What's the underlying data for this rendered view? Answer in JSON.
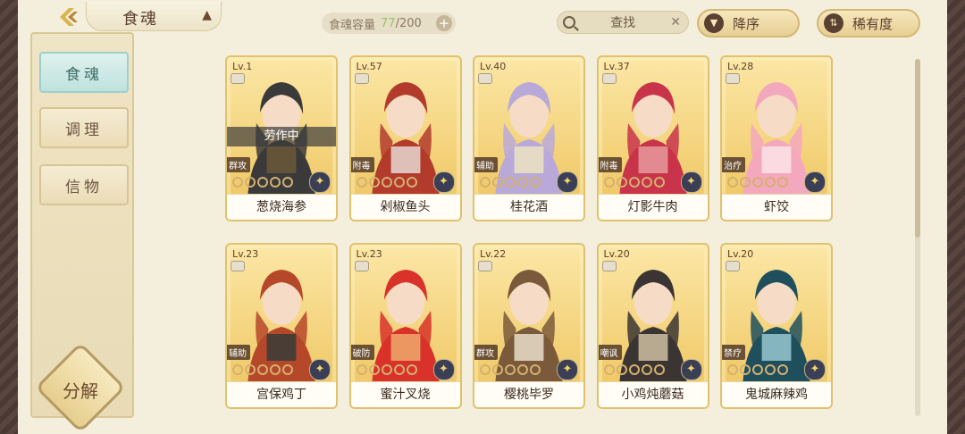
{
  "header": {
    "title": "食魂",
    "capacity_label": "食魂容量",
    "capacity_current": "77",
    "capacity_max": "/200",
    "add_symbol": "+",
    "search_placeholder": "查找",
    "search_clear": "✕",
    "sort_order_label": "降序",
    "sort_rarity_label": "稀有度"
  },
  "sidebar": {
    "items": [
      {
        "label": "食魂",
        "active": true
      },
      {
        "label": "调理",
        "active": false
      },
      {
        "label": "信物",
        "active": false
      }
    ],
    "decompose_label": "分解"
  },
  "cards": [
    {
      "level": "Lv.1",
      "name": "葱烧海参",
      "role": "群攻",
      "status": "劳作中",
      "stars": 0,
      "colors": [
        "#3b3a3a",
        "#6e5a3a"
      ]
    },
    {
      "level": "Lv.57",
      "name": "剁椒鱼头",
      "role": "附毒",
      "status": "",
      "stars": 0,
      "colors": [
        "#b23b2c",
        "#e8e2dc"
      ]
    },
    {
      "level": "Lv.40",
      "name": "桂花酒",
      "role": "辅助",
      "status": "",
      "stars": 0,
      "colors": [
        "#b8a9d9",
        "#f0e6c0"
      ]
    },
    {
      "level": "Lv.37",
      "name": "灯影牛肉",
      "role": "附毒",
      "status": "",
      "stars": 0,
      "colors": [
        "#c8344a",
        "#e8a0a0"
      ]
    },
    {
      "level": "Lv.28",
      "name": "虾饺",
      "role": "治疗",
      "status": "",
      "stars": 0,
      "colors": [
        "#f3a8bd",
        "#fde6ea"
      ]
    },
    {
      "level": "Lv.23",
      "name": "宫保鸡丁",
      "role": "辅助",
      "status": "",
      "stars": 0,
      "colors": [
        "#b6482a",
        "#2e3b3a"
      ]
    },
    {
      "level": "Lv.23",
      "name": "蜜汁叉烧",
      "role": "破防",
      "status": "",
      "stars": 0,
      "colors": [
        "#d8322a",
        "#f0b070"
      ]
    },
    {
      "level": "Lv.22",
      "name": "樱桃毕罗",
      "role": "群攻",
      "status": "",
      "stars": 0,
      "colors": [
        "#7a5a3a",
        "#f1e6d6"
      ]
    },
    {
      "level": "Lv.20",
      "name": "小鸡炖蘑菇",
      "role": "嘲讽",
      "status": "",
      "stars": 0,
      "colors": [
        "#3a3532",
        "#d8c8a8"
      ]
    },
    {
      "level": "Lv.20",
      "name": "鬼城麻辣鸡",
      "role": "禁疗",
      "status": "",
      "stars": 0,
      "colors": [
        "#1f4f5c",
        "#9fd0d8"
      ]
    }
  ]
}
